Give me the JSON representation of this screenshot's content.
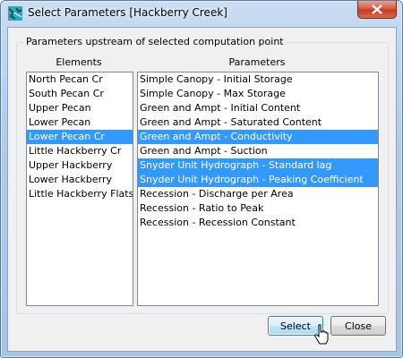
{
  "window": {
    "title": "Select Parameters [Hackberry Creek]",
    "app_icon": "hms-basin-icon",
    "close_icon": "close-icon"
  },
  "group": {
    "legend": "Parameters upstream of selected computation point"
  },
  "elements": {
    "header": "Elements",
    "items": [
      {
        "label": "North Pecan Cr",
        "selected": false
      },
      {
        "label": "South Pecan Cr",
        "selected": false
      },
      {
        "label": "Upper Pecan",
        "selected": false
      },
      {
        "label": "Lower Pecan",
        "selected": false
      },
      {
        "label": "Lower Pecan Cr",
        "selected": true
      },
      {
        "label": "Little Hackberry Cr",
        "selected": false
      },
      {
        "label": "Upper Hackberry",
        "selected": false
      },
      {
        "label": "Lower Hackberry",
        "selected": false
      },
      {
        "label": "Little Hackberry Flats",
        "selected": false
      }
    ]
  },
  "parameters": {
    "header": "Parameters",
    "items": [
      {
        "label": "Simple Canopy - Initial Storage",
        "selected": false
      },
      {
        "label": "Simple Canopy - Max Storage",
        "selected": false
      },
      {
        "label": "Green and Ampt - Initial Content",
        "selected": false
      },
      {
        "label": "Green and Ampt - Saturated Content",
        "selected": false
      },
      {
        "label": "Green and Ampt - Conductivity",
        "selected": true
      },
      {
        "label": "Green and Ampt - Suction",
        "selected": false
      },
      {
        "label": "Snyder Unit Hydrograph - Standard lag",
        "selected": true
      },
      {
        "label": "Snyder Unit Hydrograph - Peaking Coefficient",
        "selected": true
      },
      {
        "label": "Recession - Discharge per Area",
        "selected": false
      },
      {
        "label": "Recession - Ratio to Peak",
        "selected": false
      },
      {
        "label": "Recession - Recession Constant",
        "selected": false
      }
    ]
  },
  "buttons": {
    "select_label": "Select",
    "close_label": "Close"
  },
  "colors": {
    "selection": "#3399ff",
    "selection_text": "#ffffff"
  }
}
